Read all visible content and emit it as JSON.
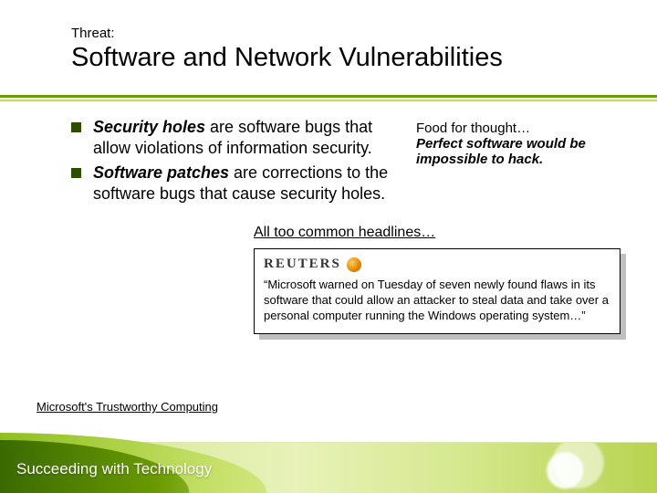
{
  "kicker": "Threat:",
  "title": "Software and Network Vulnerabilities",
  "bullets": [
    {
      "strong": "Security holes",
      "rest": " are software bugs that allow violations of information security."
    },
    {
      "strong": "Software patches",
      "rest": " are corrections to the software bugs that cause security holes."
    }
  ],
  "aside": {
    "lead": "Food for thought…",
    "body": "Perfect software would be impossible to hack."
  },
  "headlines_lead": "All too common headlines…",
  "news": {
    "logo_text": "REUTERS",
    "quote": "“Microsoft warned on Tuesday of seven newly found flaws in its software that could allow an attacker to steal data and take over a personal computer running the Windows operating system…”"
  },
  "link_text": "Microsoft's Trustworthy Computing",
  "footer": "Succeeding with Technology"
}
